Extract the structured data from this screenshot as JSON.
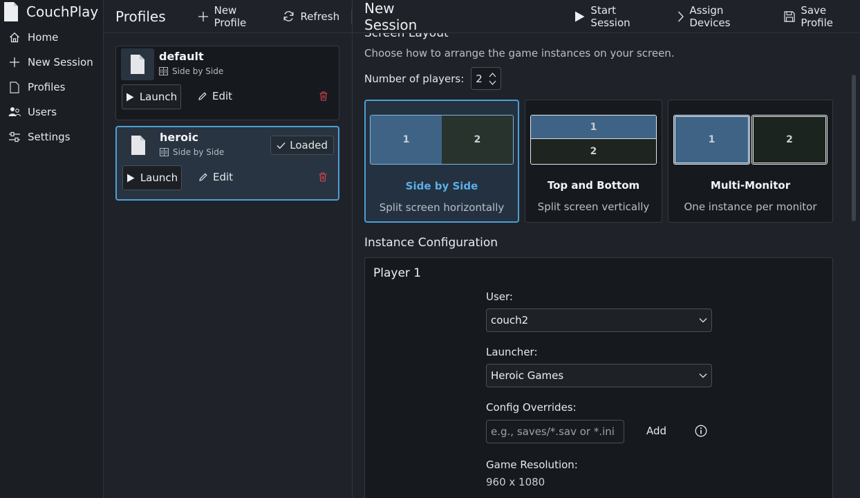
{
  "app": {
    "name": "CouchPlay"
  },
  "nav": {
    "items": [
      {
        "label": "Home",
        "icon": "home-icon"
      },
      {
        "label": "New Session",
        "icon": "plus-icon"
      },
      {
        "label": "Profiles",
        "icon": "document-icon"
      },
      {
        "label": "Users",
        "icon": "users-icon"
      },
      {
        "label": "Settings",
        "icon": "sliders-icon"
      }
    ]
  },
  "profiles_panel": {
    "title": "Profiles",
    "new_profile_label": "New Profile",
    "refresh_label": "Refresh",
    "profiles": [
      {
        "name": "default",
        "layout": "Side by Side",
        "launch_label": "Launch",
        "edit_label": "Edit",
        "loaded": false
      },
      {
        "name": "heroic",
        "layout": "Side by Side",
        "launch_label": "Launch",
        "edit_label": "Edit",
        "loaded": true,
        "loaded_label": "Loaded"
      }
    ]
  },
  "session": {
    "title": "New Session",
    "start_label": "Start Session",
    "assign_label": "Assign Devices",
    "save_label": "Save Profile",
    "screen_layout": {
      "title": "Screen Layout",
      "description": "Choose how to arrange the game instances on your screen.",
      "players_label": "Number of players:",
      "players_value": "2",
      "options": [
        {
          "name": "Side by Side",
          "desc": "Split screen horizontally",
          "pane1": "1",
          "pane2": "2",
          "selected": true
        },
        {
          "name": "Top and Bottom",
          "desc": "Split screen vertically",
          "pane1": "1",
          "pane2": "2",
          "selected": false
        },
        {
          "name": "Multi-Monitor",
          "desc": "One instance per monitor",
          "pane1": "1",
          "pane2": "2",
          "selected": false
        }
      ]
    },
    "instance_config": {
      "title": "Instance Configuration",
      "player_title": "Player 1",
      "user_label": "User:",
      "user_value": "couch2",
      "launcher_label": "Launcher:",
      "launcher_value": "Heroic Games",
      "overrides_label": "Config Overrides:",
      "overrides_placeholder": "e.g., saves/*.sav or *.ini",
      "add_label": "Add",
      "resolution_label": "Game Resolution:",
      "resolution_value": "960 x 1080"
    }
  },
  "colors": {
    "accent": "#4f9fd6",
    "danger": "#e0464f",
    "background": "#1f2329",
    "card": "#161a1f"
  }
}
